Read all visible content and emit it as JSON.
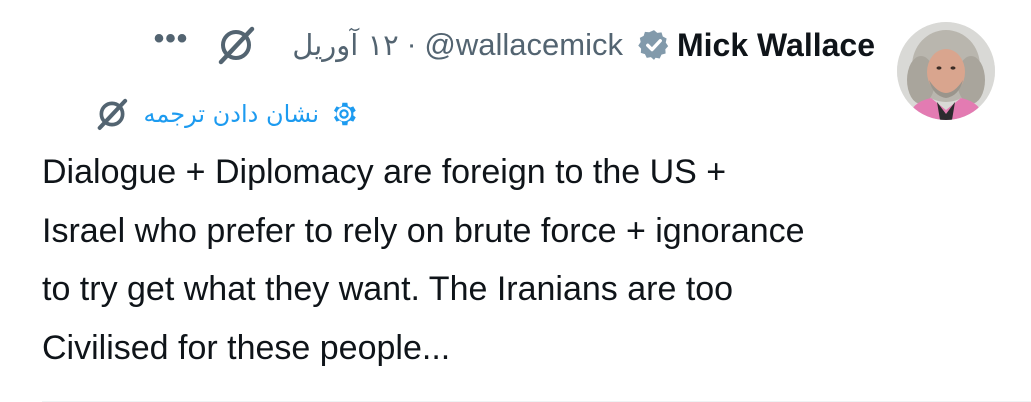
{
  "author": {
    "display_name": "Mick Wallace",
    "handle": "@wallacemick",
    "verified": true
  },
  "meta": {
    "separator": "·",
    "date": "۱۲ آوریل"
  },
  "actions": {
    "more_label": "•••",
    "grok_icon": "grok-slash-icon"
  },
  "translate": {
    "label": "نشان دادن ترجمه",
    "icon": "gear-icon"
  },
  "tweet": {
    "lines": [
      "Dialogue + Diplomacy are foreign to the US +",
      "Israel who prefer to rely on brute force + ignorance",
      "to try get what they want. The Iranians are too",
      "Civilised for these people..."
    ]
  },
  "colors": {
    "text": "#0f1419",
    "muted": "#536471",
    "link": "#1d9bf0",
    "verified_badge": "#829aab"
  }
}
